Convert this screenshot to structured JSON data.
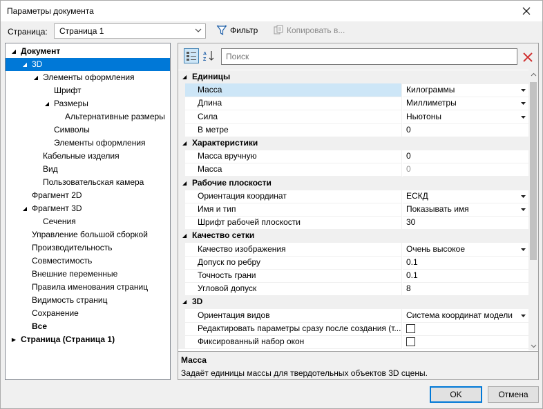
{
  "window": {
    "title": "Параметры документа"
  },
  "toolbar": {
    "page_label": "Страница:",
    "page_value": "Страница 1",
    "filter_label": "Фильтр",
    "copy_label": "Копировать в..."
  },
  "tree": [
    {
      "label": "Документ",
      "bold": true,
      "arrow": "open",
      "indent": 0
    },
    {
      "label": "3D",
      "arrow": "open",
      "indent": 1,
      "selected": true
    },
    {
      "label": "Элементы оформления",
      "arrow": "open",
      "indent": 2
    },
    {
      "label": "Шрифт",
      "indent": 3
    },
    {
      "label": "Размеры",
      "arrow": "open",
      "indent": 3
    },
    {
      "label": "Альтернативные размеры",
      "indent": 4
    },
    {
      "label": "Символы",
      "indent": 3
    },
    {
      "label": "Элементы оформления",
      "indent": 3
    },
    {
      "label": "Кабельные изделия",
      "indent": 2
    },
    {
      "label": "Вид",
      "indent": 2
    },
    {
      "label": "Пользовательская камера",
      "indent": 2
    },
    {
      "label": "Фрагмент 2D",
      "indent": 1
    },
    {
      "label": "Фрагмент 3D",
      "arrow": "open",
      "indent": 1
    },
    {
      "label": "Сечения",
      "indent": 2
    },
    {
      "label": "Управление большой сборкой",
      "indent": 1
    },
    {
      "label": "Производительность",
      "indent": 1
    },
    {
      "label": "Совместимость",
      "indent": 1
    },
    {
      "label": "Внешние переменные",
      "indent": 1
    },
    {
      "label": "Правила именования страниц",
      "indent": 1
    },
    {
      "label": "Видимость страниц",
      "indent": 1
    },
    {
      "label": "Сохранение",
      "indent": 1
    },
    {
      "label": "Все",
      "bold": true,
      "indent": 1
    },
    {
      "label": "Страница (Страница 1)",
      "bold": true,
      "arrow": "closed",
      "indent": 0
    }
  ],
  "search": {
    "placeholder": "Поиск"
  },
  "grid": [
    {
      "type": "cat",
      "label": "Единицы"
    },
    {
      "type": "prop",
      "name": "Масса",
      "value": "Килограммы",
      "dropdown": true,
      "selected": true
    },
    {
      "type": "prop",
      "name": "Длина",
      "value": "Миллиметры",
      "dropdown": true
    },
    {
      "type": "prop",
      "name": "Сила",
      "value": "Ньютоны",
      "dropdown": true
    },
    {
      "type": "prop",
      "name": "В метре",
      "value": "0"
    },
    {
      "type": "cat",
      "label": "Характеристики"
    },
    {
      "type": "prop",
      "name": "Масса вручную",
      "value": "0"
    },
    {
      "type": "prop",
      "name": "Масса",
      "value": "0",
      "disabled": true
    },
    {
      "type": "cat",
      "label": "Рабочие плоскости"
    },
    {
      "type": "prop",
      "name": "Ориентация координат",
      "value": "ЕСКД",
      "dropdown": true
    },
    {
      "type": "prop",
      "name": "Имя и тип",
      "value": "Показывать имя",
      "dropdown": true
    },
    {
      "type": "prop",
      "name": "Шрифт рабочей плоскости",
      "value": "30"
    },
    {
      "type": "cat",
      "label": "Качество сетки"
    },
    {
      "type": "prop",
      "name": "Качество изображения",
      "value": "Очень высокое",
      "dropdown": true
    },
    {
      "type": "prop",
      "name": "Допуск по ребру",
      "value": "0.1"
    },
    {
      "type": "prop",
      "name": "Точность грани",
      "value": "0.1"
    },
    {
      "type": "prop",
      "name": "Угловой допуск",
      "value": "8"
    },
    {
      "type": "cat",
      "label": "3D"
    },
    {
      "type": "prop",
      "name": "Ориентация видов",
      "value": "Система координат модели",
      "dropdown": true
    },
    {
      "type": "prop",
      "name": "Редактировать параметры сразу после создания (т...",
      "checkbox": true
    },
    {
      "type": "prop",
      "name": "Фиксированный набор окон",
      "checkbox": true
    }
  ],
  "description": {
    "title": "Масса",
    "text": "Задаёт единицы массы для твердотельных объектов 3D сцены."
  },
  "buttons": {
    "ok": "OK",
    "cancel": "Отмена"
  }
}
